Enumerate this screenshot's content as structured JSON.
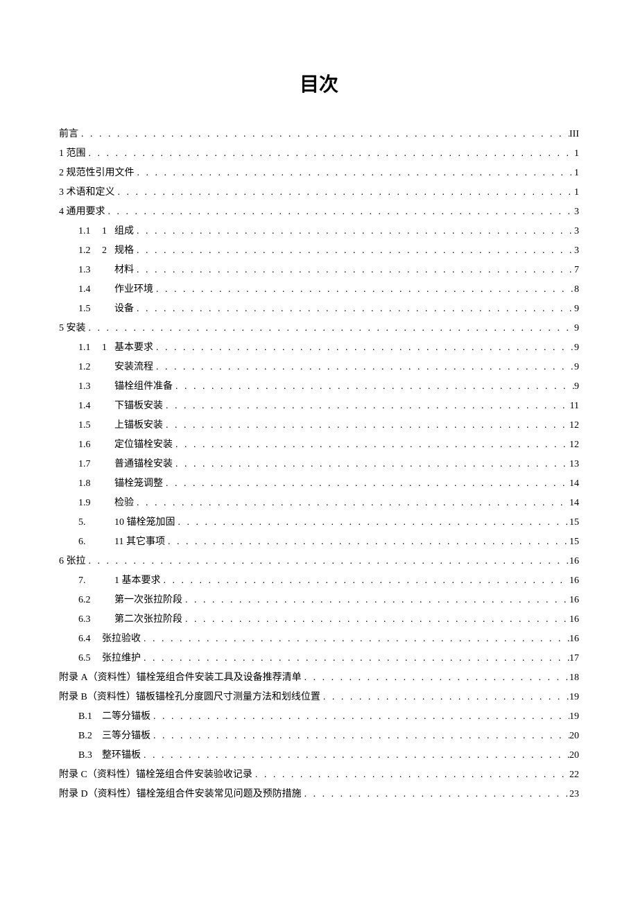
{
  "title": "目次",
  "entries": [
    {
      "indent": 0,
      "label": "前言",
      "page": "III"
    },
    {
      "indent": 0,
      "label": "1 范围",
      "page": "1"
    },
    {
      "indent": 0,
      "label": "2 规范性引用文件",
      "page": "1"
    },
    {
      "indent": 0,
      "label": "3 术语和定义",
      "page": "1"
    },
    {
      "indent": 0,
      "label": "4 通用要求",
      "page": "3"
    },
    {
      "indent": 1,
      "num": "1.1",
      "sub": "1",
      "label": "组成",
      "page": "3"
    },
    {
      "indent": 1,
      "num": "1.2",
      "sub": "2",
      "label": "规格",
      "page": "3"
    },
    {
      "indent": 1,
      "num": "1.3",
      "sub": "",
      "label": "材料",
      "page": "7"
    },
    {
      "indent": 1,
      "num": "1.4",
      "sub": "",
      "label": "作业环境",
      "page": "8"
    },
    {
      "indent": 1,
      "num": "1.5",
      "sub": "",
      "label": "设备",
      "page": "9"
    },
    {
      "indent": 0,
      "label": "5 安装",
      "page": "9"
    },
    {
      "indent": 1,
      "num": "1.1",
      "sub": "1",
      "label": "基本要求",
      "page": "9"
    },
    {
      "indent": 1,
      "num": "1.2",
      "sub": "",
      "label": "安装流程",
      "page": "9"
    },
    {
      "indent": 1,
      "num": "1.3",
      "sub": "",
      "label": "锚栓组件准备",
      "page": "9"
    },
    {
      "indent": 1,
      "num": "1.4",
      "sub": "",
      "label": "下锚板安装",
      "page": "11"
    },
    {
      "indent": 1,
      "num": "1.5",
      "sub": "",
      "label": "上锚板安装",
      "page": "12"
    },
    {
      "indent": 1,
      "num": "1.6",
      "sub": "",
      "label": "定位锚栓安装",
      "page": "12"
    },
    {
      "indent": 1,
      "num": "1.7",
      "sub": "",
      "label": "普通锚栓安装",
      "page": "13"
    },
    {
      "indent": 1,
      "num": "1.8",
      "sub": "",
      "label": "锚栓笼调整",
      "page": "14"
    },
    {
      "indent": 1,
      "num": "1.9",
      "sub": "",
      "label": "检验",
      "page": "14"
    },
    {
      "indent": 1,
      "num": "5.",
      "sub": "",
      "label": "10 锚栓笼加固",
      "page": "15"
    },
    {
      "indent": 1,
      "num": "6.",
      "sub": "",
      "label": "11 其它事项",
      "page": "15"
    },
    {
      "indent": 0,
      "label": "6 张拉",
      "page": "16"
    },
    {
      "indent": 1,
      "num": "7.",
      "sub": "",
      "label": "1 基本要求",
      "page": "16"
    },
    {
      "indent": 1,
      "num": "6.2",
      "sub": "",
      "label": "第一次张拉阶段",
      "page": "16"
    },
    {
      "indent": 1,
      "num": "6.3",
      "sub": "",
      "label": "第二次张拉阶段",
      "page": "16"
    },
    {
      "indent": 1,
      "num": "6.4",
      "sub": "",
      "label": "张拉验收",
      "nogap": true,
      "page": "16"
    },
    {
      "indent": 1,
      "num": "6.5",
      "sub": "",
      "label": "张拉维护",
      "nogap": true,
      "page": "17"
    },
    {
      "indent": 0,
      "label": "附录 A（资料性）锚栓笼组合件安装工具及设备推荐清单",
      "page": "18"
    },
    {
      "indent": 0,
      "label": "附录 B（资料性）锚板锚栓孔分度圆尺寸测量方法和划线位置",
      "page": "19"
    },
    {
      "indent": 1,
      "num": "B.1",
      "sub": "",
      "label": "二等分锚板",
      "nogap": true,
      "page": "19"
    },
    {
      "indent": 1,
      "num": "B.2",
      "sub": "",
      "label": "三等分锚板",
      "nogap": true,
      "page": "20"
    },
    {
      "indent": 1,
      "num": "B.3",
      "sub": "",
      "label": "整环锚板",
      "nogap": true,
      "page": "20"
    },
    {
      "indent": 0,
      "label": "附录 C（资料性）锚栓笼组合件安装验收记录",
      "page": "22"
    },
    {
      "indent": 0,
      "label": "附录 D（资料性）锚栓笼组合件安装常见问题及预防措施",
      "page": "23"
    }
  ]
}
